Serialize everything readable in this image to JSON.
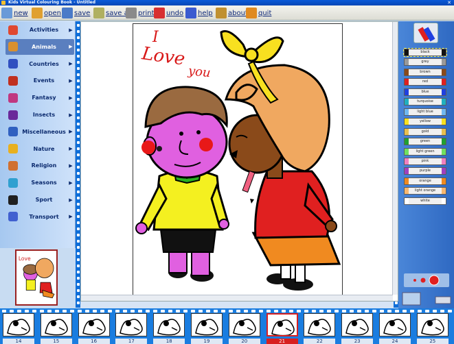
{
  "window": {
    "title": "Kids Virtual Colouring Book - Untitled",
    "close_glyph": "✕"
  },
  "toolbar": [
    {
      "name": "new",
      "label": "new",
      "color": "#6a9ad8"
    },
    {
      "name": "open",
      "label": "open",
      "color": "#e0a030"
    },
    {
      "name": "save",
      "label": "save",
      "color": "#4a7ac8"
    },
    {
      "name": "save-as",
      "label": "save as",
      "color": "#b0b060"
    },
    {
      "name": "print",
      "label": "print",
      "color": "#8a8a8a"
    },
    {
      "name": "undo",
      "label": "undo",
      "color": "#d83030"
    },
    {
      "name": "help",
      "label": "help",
      "color": "#3a5ad0"
    },
    {
      "name": "about",
      "label": "about",
      "color": "#c09030"
    },
    {
      "name": "quit",
      "label": "quit",
      "color": "#e08a20"
    }
  ],
  "categories": [
    {
      "label": "Activities",
      "color": "#e04830"
    },
    {
      "label": "Animals",
      "color": "#d89030"
    },
    {
      "label": "Countries",
      "color": "#3050c0"
    },
    {
      "label": "Events",
      "color": "#c03020"
    },
    {
      "label": "Fantasy",
      "color": "#c03880"
    },
    {
      "label": "Insects",
      "color": "#6a2a9a"
    },
    {
      "label": "Miscellaneous",
      "color": "#3060c0"
    },
    {
      "label": "Nature",
      "color": "#e8b020"
    },
    {
      "label": "Religion",
      "color": "#d07030"
    },
    {
      "label": "Seasons",
      "color": "#30a0d0"
    },
    {
      "label": "Sport",
      "color": "#202020"
    },
    {
      "label": "Transport",
      "color": "#4060d0"
    }
  ],
  "selected_category": "Animals",
  "arrow_glyph": "▶",
  "drawing": {
    "caption_line1": "I",
    "caption_line2": "Love",
    "caption_line3": "you"
  },
  "crayons": [
    {
      "label": "black",
      "color": "#111111"
    },
    {
      "label": "grey",
      "color": "#9a9a9a"
    },
    {
      "label": "brown",
      "color": "#8a4a1a"
    },
    {
      "label": "red",
      "color": "#e02020"
    },
    {
      "label": "blue",
      "color": "#2040e0"
    },
    {
      "label": "turquoise",
      "color": "#20b0c0"
    },
    {
      "label": "light blue",
      "color": "#70b8f0"
    },
    {
      "label": "yellow",
      "color": "#f8e020"
    },
    {
      "label": "gold",
      "color": "#e8c050"
    },
    {
      "label": "green",
      "color": "#20a030"
    },
    {
      "label": "light green",
      "color": "#70e060"
    },
    {
      "label": "pink",
      "color": "#f080c0"
    },
    {
      "label": "purple",
      "color": "#a040c0"
    },
    {
      "label": "orange",
      "color": "#f08a20"
    },
    {
      "label": "light orange",
      "color": "#f8b870"
    },
    {
      "label": "white",
      "color": "#ffffff"
    }
  ],
  "selected_crayon": "black",
  "thumbnails": [
    "14",
    "15",
    "16",
    "17",
    "18",
    "19",
    "20",
    "21",
    "22",
    "23",
    "24",
    "25"
  ],
  "current_thumbnail": "21"
}
